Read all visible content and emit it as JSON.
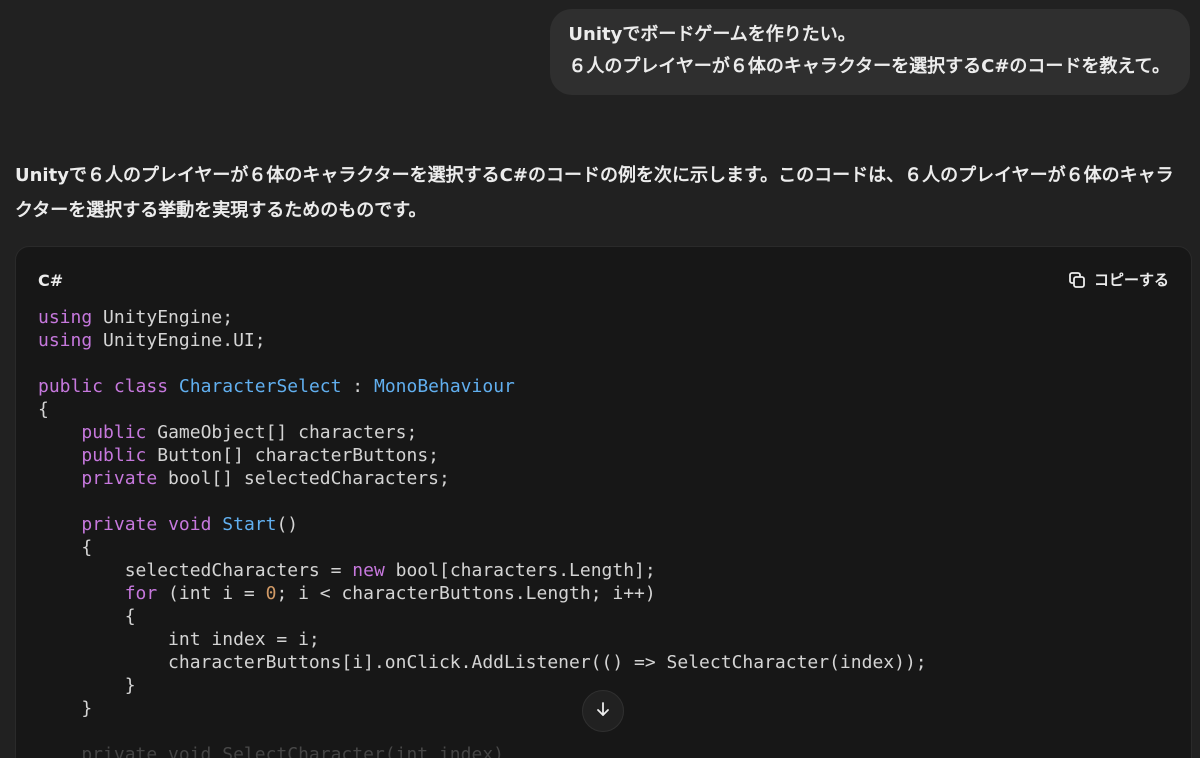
{
  "user_message": {
    "lines": [
      "Unityでボードゲームを作りたい。",
      "６人のプレイヤーが６体のキャラクターを選択するC#のコードを教えて。"
    ]
  },
  "assistant": {
    "intro": "Unityで６人のプレイヤーが６体のキャラクターを選択するC#のコードの例を次に示します。このコードは、６人のプレイヤーが６体のキャラクターを選択する挙動を実現するためのものです。"
  },
  "code_block": {
    "language": "C#",
    "copy_label": "コピーする",
    "copy_icon": "copy-icon",
    "lines": [
      [
        [
          "using",
          "kw"
        ],
        [
          " UnityEngine;",
          ""
        ]
      ],
      [
        [
          "using",
          "kw"
        ],
        [
          " UnityEngine.UI;",
          ""
        ]
      ],
      [],
      [
        [
          "public",
          "kw"
        ],
        [
          " ",
          ""
        ],
        [
          "class",
          "kw"
        ],
        [
          " ",
          ""
        ],
        [
          "CharacterSelect",
          "ty"
        ],
        [
          " : ",
          ""
        ],
        [
          "MonoBehaviour",
          "ty"
        ]
      ],
      [
        [
          "{",
          ""
        ]
      ],
      [
        [
          "    ",
          ""
        ],
        [
          "public",
          "kw"
        ],
        [
          " GameObject[] characters;",
          ""
        ]
      ],
      [
        [
          "    ",
          ""
        ],
        [
          "public",
          "kw"
        ],
        [
          " Button[] characterButtons;",
          ""
        ]
      ],
      [
        [
          "    ",
          ""
        ],
        [
          "private",
          "kw"
        ],
        [
          " bool[] selectedCharacters;",
          ""
        ]
      ],
      [],
      [
        [
          "    ",
          ""
        ],
        [
          "private",
          "kw"
        ],
        [
          " ",
          ""
        ],
        [
          "void",
          "kw"
        ],
        [
          " ",
          ""
        ],
        [
          "Start",
          "ty"
        ],
        [
          "()",
          ""
        ]
      ],
      [
        [
          "    {",
          ""
        ]
      ],
      [
        [
          "        selectedCharacters = ",
          ""
        ],
        [
          "new",
          "kw"
        ],
        [
          " bool[characters.Length];",
          ""
        ]
      ],
      [
        [
          "        ",
          ""
        ],
        [
          "for",
          "kw"
        ],
        [
          " (int i = ",
          ""
        ],
        [
          "0",
          "num"
        ],
        [
          "; i < characterButtons.Length; i++)",
          ""
        ]
      ],
      [
        [
          "        {",
          ""
        ]
      ],
      [
        [
          "            int index = i;",
          ""
        ]
      ],
      [
        [
          "            characterButtons[i].onClick.AddListener(() => SelectCharacter(index));",
          ""
        ]
      ],
      [
        [
          "        }",
          ""
        ]
      ],
      [
        [
          "    }",
          ""
        ]
      ],
      [],
      [
        [
          "    private void SelectCharacter(int index)",
          "fade-line"
        ]
      ]
    ]
  },
  "scroll_button": {
    "icon": "arrow-down-icon"
  },
  "colors": {
    "background": "#212121",
    "user_bubble": "#2f2f2f",
    "code_bg": "#171717",
    "keyword": "#c678dd",
    "type": "#61afef",
    "number": "#d19a66"
  }
}
